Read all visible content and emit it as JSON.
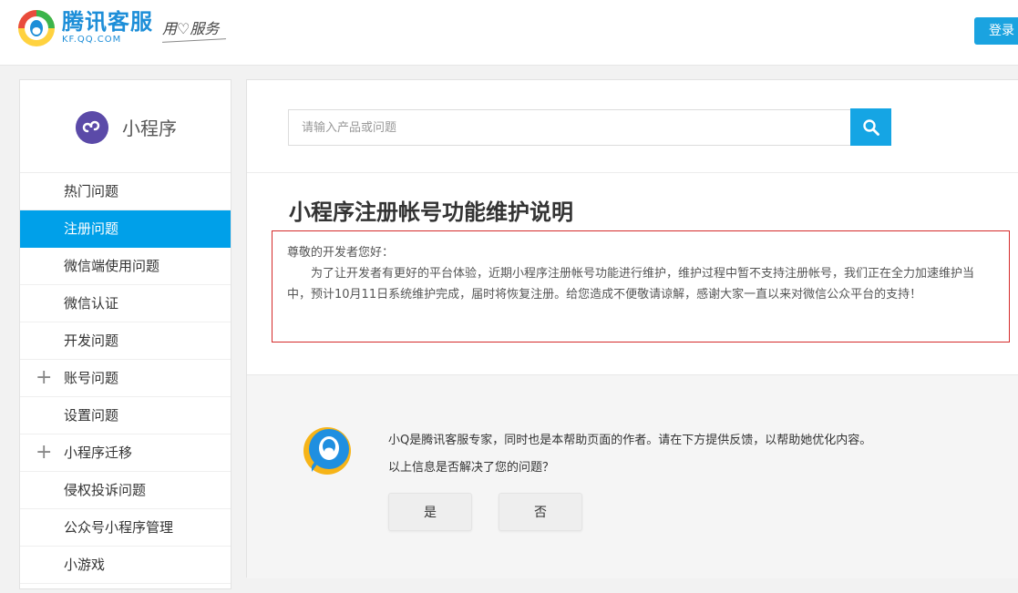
{
  "header": {
    "brand": "腾讯客服",
    "brand_sub": "KF.QQ.COM",
    "slogan": "用♡服务",
    "login_label": "登录"
  },
  "sidebar": {
    "title": "小程序",
    "items": [
      {
        "label": "热门问题",
        "expandable": false,
        "active": false
      },
      {
        "label": "注册问题",
        "expandable": false,
        "active": true
      },
      {
        "label": "微信端使用问题",
        "expandable": false,
        "active": false
      },
      {
        "label": "微信认证",
        "expandable": false,
        "active": false
      },
      {
        "label": "开发问题",
        "expandable": false,
        "active": false
      },
      {
        "label": "账号问题",
        "expandable": true,
        "active": false
      },
      {
        "label": "设置问题",
        "expandable": false,
        "active": false
      },
      {
        "label": "小程序迁移",
        "expandable": true,
        "active": false
      },
      {
        "label": "侵权投诉问题",
        "expandable": false,
        "active": false
      },
      {
        "label": "公众号小程序管理",
        "expandable": false,
        "active": false
      },
      {
        "label": "小游戏",
        "expandable": false,
        "active": false
      }
    ],
    "plus_symbol": "+"
  },
  "search": {
    "placeholder": "请输入产品或问题"
  },
  "article": {
    "title": "小程序注册帐号功能维护说明",
    "greeting": "尊敬的开发者您好：",
    "body": "为了让开发者有更好的平台体验，近期小程序注册帐号功能进行维护，维护过程中暂不支持注册帐号，我们正在全力加速维护当中，预计10月11日系统维护完成，届时将恢复注册。给您造成不便敬请谅解，感谢大家一直以来对微信公众平台的支持！"
  },
  "feedback": {
    "intro": "小Q是腾讯客服专家，同时也是本帮助页面的作者。请在下方提供反馈，以帮助她优化内容。",
    "question": "以上信息是否解决了您的问题？",
    "yes_label": "是",
    "no_label": "否"
  },
  "colors": {
    "accent": "#00a0e9",
    "notice_border": "#d52b2b",
    "sidebar_logo": "#5b4aa8"
  }
}
